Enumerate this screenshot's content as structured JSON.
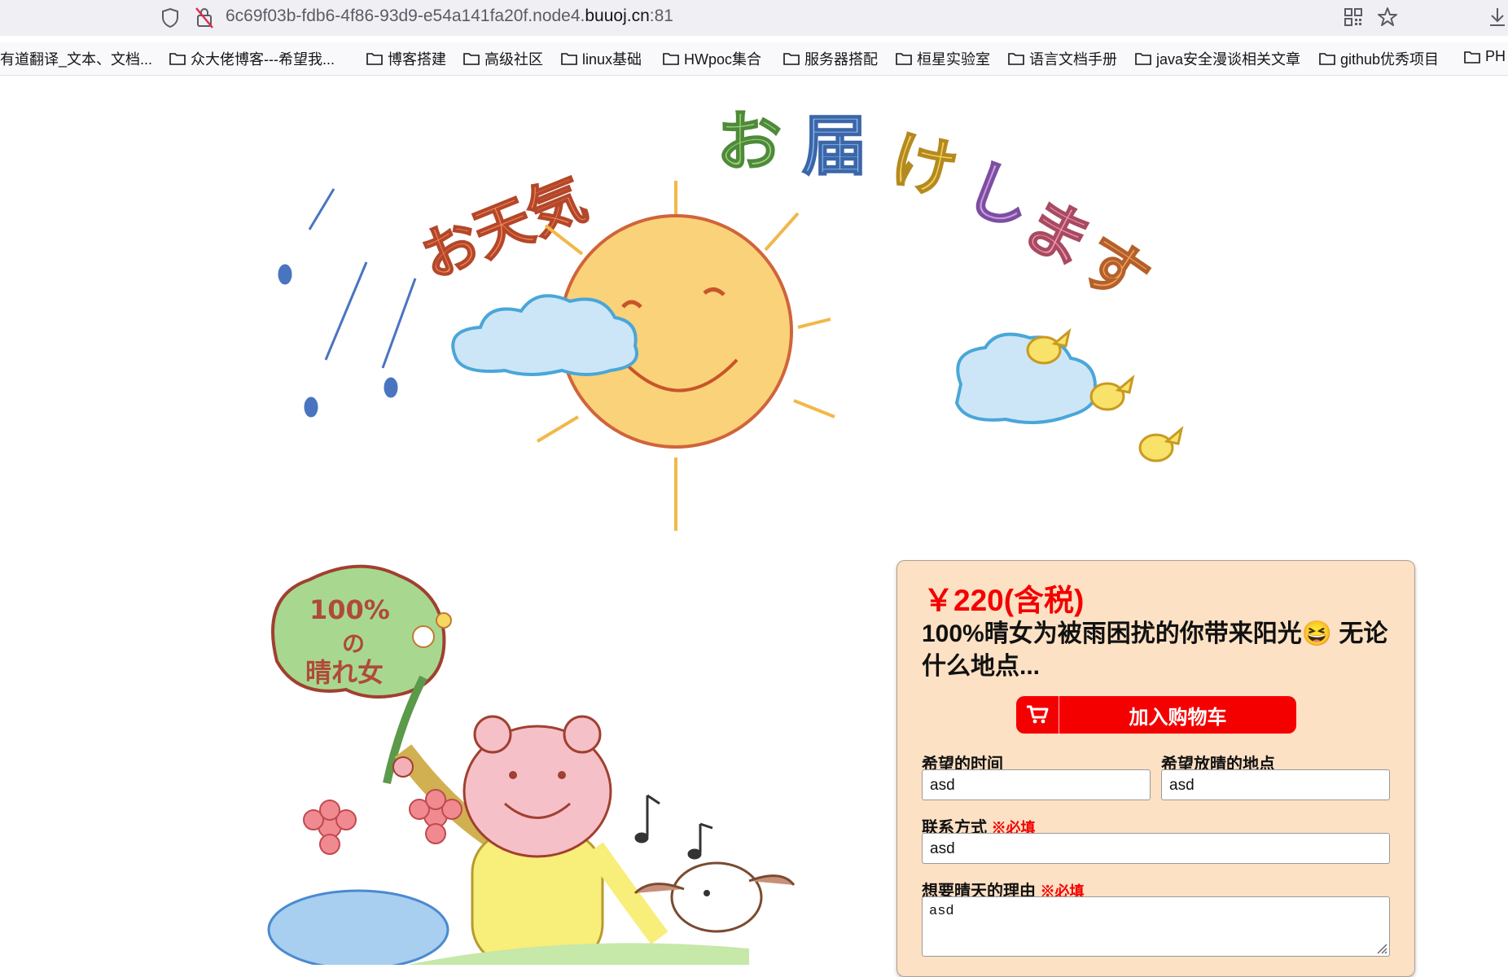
{
  "browser": {
    "url_prefix": "6c69f03b-fdb6-4f86-93d9-e54a141fa20f.node4.",
    "url_domain": "buuoj.cn",
    "url_port": ":81",
    "bookmarks": [
      "有道翻译_文本、文档...",
      "众大佬博客---希望我...",
      "博客搭建",
      "高级社区",
      "linux基础",
      "HWpoc集合",
      "服务器搭配",
      "桓星实验室",
      "语言文档手册",
      "java安全漫谈相关文章",
      "github优秀项目",
      "PH"
    ]
  },
  "banner": {
    "headline": "お天気お届けします",
    "leaf_text_1": "100%",
    "leaf_text_2": "の",
    "leaf_text_3": "晴れ女"
  },
  "product": {
    "price": "￥220(含税)",
    "title": "100%晴女为被雨困扰的你带来阳光😆 无论什么地点...",
    "cart_button": "加入购物车",
    "fields": {
      "time_label": "希望的时间",
      "time_value": "asd",
      "place_label": "希望放晴的地点",
      "place_value": "asd",
      "contact_label": "联系方式",
      "contact_required": "※必填",
      "contact_value": "asd",
      "reason_label": "想要晴天的理由",
      "reason_required": "※必填",
      "reason_value": "asd"
    }
  },
  "colors": {
    "price_red": "#f40000",
    "card_bg": "#fde1c4"
  }
}
